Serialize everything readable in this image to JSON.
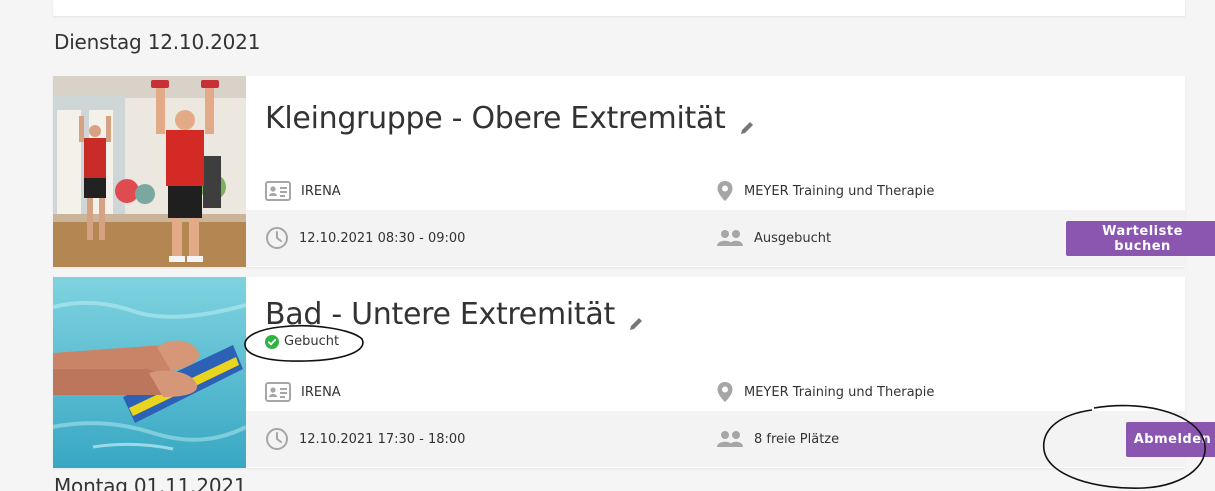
{
  "top_day": {
    "heading": "Dienstag 12.10.2021"
  },
  "courses": [
    {
      "title": "Kleingruppe - Obere Extremität",
      "instructor": "IRENA",
      "location": "MEYER Training und Therapie",
      "datetime": "12.10.2021 08:30 - 09:00",
      "availability": "Ausgebucht",
      "action_label": "Warteliste buchen",
      "image": "man-exercising-with-dumbbells-photo"
    },
    {
      "title": "Bad - Untere Extremität",
      "status": "Gebucht",
      "instructor": "IRENA",
      "location": "MEYER Training und Therapie",
      "datetime": "12.10.2021 17:30 - 18:00",
      "availability": "8 freie Plätze",
      "action_label": "Abmelden",
      "image": "hands-on-swim-board-photo"
    }
  ],
  "next_day": {
    "heading": "Montag 01.11.2021"
  },
  "colors": {
    "accent": "#8b56b0",
    "success": "#2fb344",
    "icon_gray": "#a6a6a6",
    "text": "#333333",
    "row_background": "#f3f3f3"
  },
  "icons": {
    "edit": "pencil-icon",
    "instructor": "id-card-icon",
    "location": "map-pin-icon",
    "time": "clock-icon",
    "participants": "users-icon",
    "status": "check-circle-icon"
  }
}
